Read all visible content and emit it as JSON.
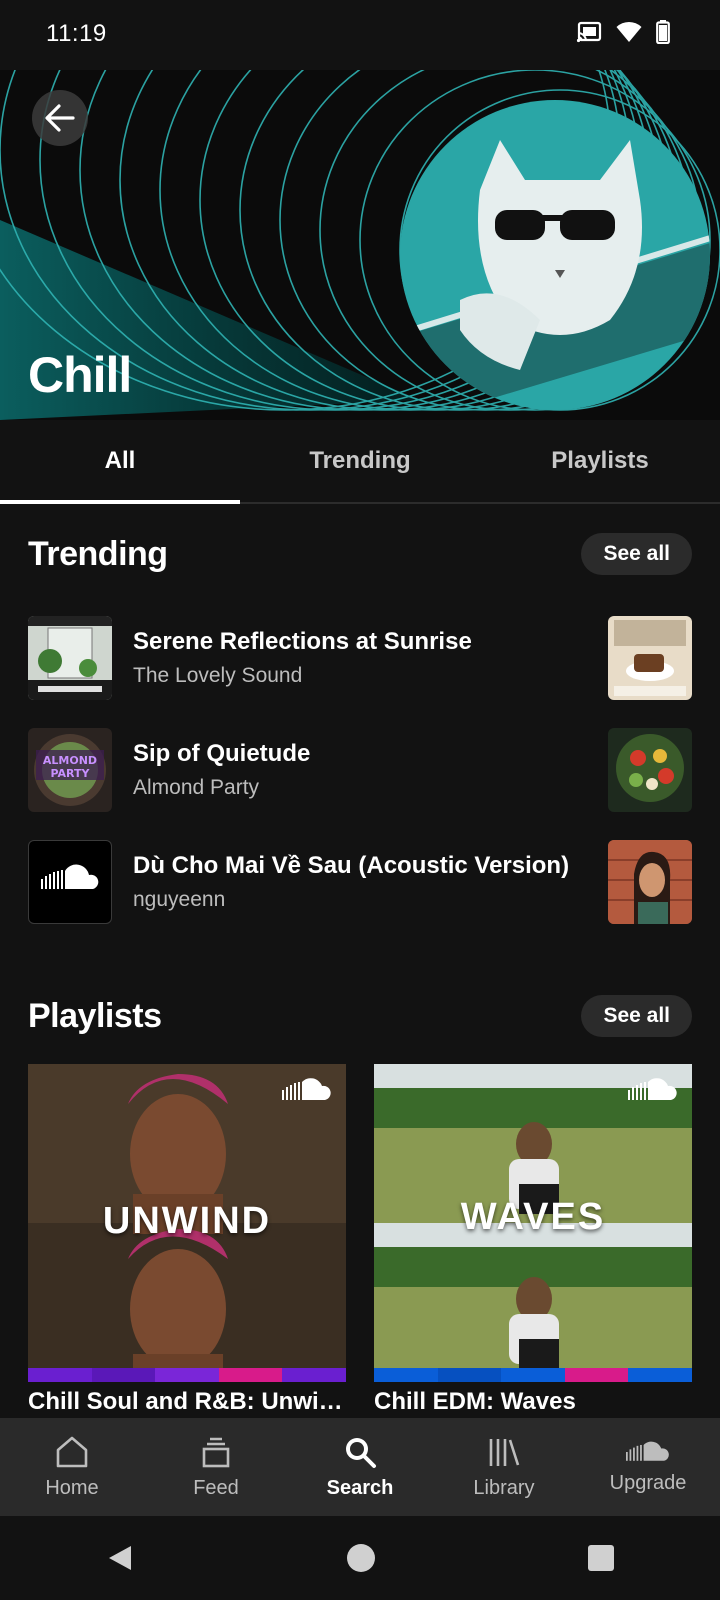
{
  "status_bar": {
    "time": "11:19",
    "icons": [
      "cast-icon",
      "wifi-icon",
      "battery-icon"
    ]
  },
  "hero": {
    "title": "Chill",
    "accent": "#2aa6a6"
  },
  "tabs": [
    {
      "label": "All",
      "active": true
    },
    {
      "label": "Trending",
      "active": false
    },
    {
      "label": "Playlists",
      "active": false
    }
  ],
  "trending": {
    "title": "Trending",
    "see_all": "See all",
    "tracks": [
      {
        "title": "Serene Reflections at Sunrise",
        "artist": "The Lovely Sound"
      },
      {
        "title": "Sip of Quietude",
        "artist": "Almond Party"
      },
      {
        "title": "Dù Cho Mai Về Sau (Acoustic Version)",
        "artist": "nguyeenn"
      }
    ]
  },
  "playlists": {
    "title": "Playlists",
    "see_all": "See all",
    "items": [
      {
        "cover_text": "UNWIND",
        "label": "Chill Soul and R&B: Unwind",
        "strip_colors": [
          "#6a1fd0",
          "#5a18b8",
          "#7a26d8",
          "#d81b8a",
          "#6a1fd0"
        ]
      },
      {
        "cover_text": "WAVES",
        "label": "Chill EDM: Waves",
        "strip_colors": [
          "#0a5ed8",
          "#0650c0",
          "#0a5ed8",
          "#d81b8a",
          "#0a5ed8"
        ]
      }
    ]
  },
  "bottom_nav": [
    {
      "label": "Home",
      "icon": "home-icon",
      "active": false
    },
    {
      "label": "Feed",
      "icon": "feed-icon",
      "active": false
    },
    {
      "label": "Search",
      "icon": "search-icon",
      "active": true
    },
    {
      "label": "Library",
      "icon": "library-icon",
      "active": false
    },
    {
      "label": "Upgrade",
      "icon": "soundcloud-icon",
      "active": false
    }
  ]
}
